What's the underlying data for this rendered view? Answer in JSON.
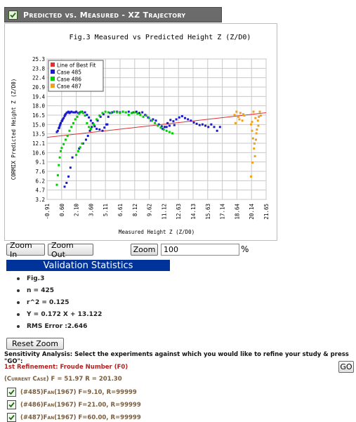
{
  "header": {
    "title": "Predicted vs. Measured - XZ Trajectory",
    "checkbox_checked": true
  },
  "chart_data": {
    "type": "scatter",
    "title": "Fig.3 Measured vs Predicted Height Z (Z/D0)",
    "xlabel": "Measured Height Z (Z/D0)",
    "ylabel": "CORMIX Predicted Height Z (Z/D0)",
    "xticks": [
      "-0.91",
      "0.60",
      "2.10",
      "3.60",
      "5.11",
      "6.61",
      "8.12",
      "9.62",
      "11.12",
      "12.63",
      "14.13",
      "15.63",
      "17.14",
      "18.64",
      "20.14",
      "21.65"
    ],
    "yticks": [
      "3.2",
      "4.7",
      "6.2",
      "7.6",
      "9.1",
      "10.6",
      "12.1",
      "13.5",
      "15.0",
      "16.5",
      "18.0",
      "19.4",
      "20.9",
      "22.4",
      "23.8",
      "25.3"
    ],
    "xlim": [
      -0.91,
      21.65
    ],
    "ylim": [
      3.2,
      25.3
    ],
    "grid": true,
    "legend_position": "top-left",
    "best_fit": {
      "name": "Line of Best Fit",
      "slope": 0.172,
      "intercept": 13.122,
      "color": "#e03030"
    },
    "series": [
      {
        "name": "Case 485",
        "color": "#1a1acc",
        "x": [
          0.1,
          0.2,
          0.3,
          0.35,
          0.4,
          0.45,
          0.5,
          0.6,
          0.65,
          0.7,
          0.8,
          0.9,
          0.95,
          1.0,
          1.1,
          1.2,
          1.3,
          1.4,
          1.5,
          1.6,
          1.8,
          2.0,
          2.1,
          2.3,
          2.5,
          2.7,
          3.0,
          3.2,
          3.4,
          3.6,
          3.8,
          4.0,
          4.2,
          4.5,
          4.8,
          5.0,
          5.2,
          5.4,
          5.6,
          5.8,
          6.0,
          6.3,
          6.6,
          6.9,
          7.2,
          7.5,
          7.8,
          8.0,
          8.3,
          8.6,
          8.9,
          9.2,
          9.5,
          9.8,
          10.0,
          10.3,
          10.6,
          10.9,
          11.2,
          11.5,
          11.8,
          12.1,
          12.4,
          12.7,
          13.0,
          13.3,
          13.6,
          13.9,
          14.2,
          14.5,
          14.8,
          15.1,
          15.4,
          15.7,
          16.0,
          16.3,
          16.6,
          16.9,
          0.9,
          1.1,
          1.3,
          1.5,
          1.7,
          2.4,
          2.8,
          3.1,
          3.3,
          3.5,
          3.7,
          4.3,
          4.6,
          4.9,
          5.3,
          11.0,
          11.4,
          11.7,
          12.2
        ],
        "y": [
          13.8,
          14.0,
          14.4,
          14.5,
          14.8,
          15.0,
          15.2,
          15.5,
          15.6,
          15.8,
          16.0,
          16.3,
          16.5,
          16.6,
          16.8,
          16.9,
          17.0,
          16.8,
          16.9,
          17.0,
          16.9,
          16.9,
          17.0,
          16.8,
          16.9,
          17.0,
          16.9,
          16.5,
          16.1,
          15.6,
          15.2,
          14.7,
          14.3,
          14.2,
          14.0,
          14.5,
          15.0,
          16.2,
          16.8,
          16.9,
          17.0,
          17.0,
          16.9,
          17.0,
          16.9,
          17.0,
          16.8,
          16.9,
          17.0,
          16.8,
          16.9,
          16.5,
          16.1,
          15.6,
          15.8,
          15.6,
          15.0,
          14.7,
          14.6,
          15.2,
          15.7,
          15.5,
          15.8,
          16.1,
          16.3,
          16.0,
          15.8,
          15.6,
          15.3,
          15.1,
          14.9,
          15.0,
          14.8,
          14.6,
          15.0,
          14.6,
          14.0,
          14.6,
          5.2,
          5.8,
          6.8,
          8.2,
          9.8,
          11.2,
          12.0,
          12.6,
          13.2,
          14.0,
          14.6,
          15.6,
          16.2,
          16.6,
          15.0,
          14.3,
          14.6,
          14.8,
          14.9
        ]
      },
      {
        "name": "Case 486",
        "color": "#00cc00",
        "x": [
          0.1,
          0.2,
          0.3,
          0.4,
          0.5,
          0.6,
          0.8,
          1.0,
          1.2,
          1.4,
          1.6,
          1.8,
          2.0,
          2.2,
          2.4,
          2.6,
          2.8,
          3.0,
          3.2,
          3.4,
          3.6,
          3.9,
          4.2,
          4.5,
          4.8,
          5.1,
          5.4,
          5.7,
          6.0,
          6.3,
          6.6,
          6.9,
          7.2,
          7.5,
          7.8,
          8.1,
          8.4,
          8.7,
          9.0,
          9.3,
          9.6,
          9.9,
          10.2,
          10.5,
          10.8,
          11.1,
          11.4,
          11.7,
          12.0,
          2.1,
          2.3,
          2.5,
          2.7
        ],
        "y": [
          5.5,
          7.0,
          8.6,
          9.8,
          10.8,
          11.3,
          11.9,
          12.6,
          13.2,
          14.0,
          14.6,
          15.2,
          15.8,
          16.2,
          16.7,
          17.0,
          16.8,
          16.4,
          15.2,
          14.6,
          14.3,
          15.0,
          15.8,
          16.4,
          16.8,
          17.0,
          16.9,
          16.8,
          17.0,
          16.9,
          16.8,
          17.0,
          16.9,
          16.5,
          16.8,
          16.9,
          16.7,
          16.5,
          16.2,
          16.4,
          16.0,
          15.6,
          15.2,
          14.8,
          14.5,
          14.2,
          14.0,
          13.8,
          13.6,
          10.2,
          10.8,
          11.4,
          12.0
        ]
      },
      {
        "name": "Case 487",
        "color": "#f0a020",
        "x": [
          18.4,
          18.6,
          18.8,
          19.0,
          19.2,
          19.4,
          18.5,
          18.9,
          19.3,
          20.1,
          20.2,
          20.3,
          20.4,
          20.5,
          20.6,
          20.7,
          20.8,
          20.9,
          21.0,
          21.1,
          20.25,
          20.45,
          20.65,
          20.85,
          20.2,
          20.35,
          20.55,
          20.1
        ],
        "y": [
          16.5,
          17.0,
          16.2,
          16.8,
          15.6,
          16.4,
          15.2,
          15.8,
          16.6,
          15.0,
          14.0,
          12.8,
          11.2,
          10.0,
          12.6,
          14.2,
          15.6,
          16.2,
          17.0,
          16.4,
          9.0,
          12.0,
          13.6,
          14.8,
          15.4,
          17.0,
          16.0,
          6.8
        ]
      }
    ]
  },
  "controls": {
    "zoom_in_label": "Zoom In",
    "zoom_out_label": "Zoom Out",
    "zoom_label": "Zoom",
    "zoom_value": "100",
    "pct_symbol": "%",
    "reset_label": "Reset Zoom",
    "go_label": "GO"
  },
  "stats": {
    "title": "Validation Statistics",
    "items": [
      "Fig.3",
      "n = 425",
      "r^2 = 0.125",
      "Y = 0.172 X + 13.122",
      "RMS Error :2.646"
    ]
  },
  "sensitivity": {
    "text": "Sensitivity Analysis: Select the experiments against which you would like to refine your study & press \"GO\":",
    "refinement": "1st Refinement: Froude Number (F0)",
    "current_case": "(Current Case) F = 51.97 R = 201.30",
    "experiments": [
      {
        "label": "(#485)Fan(1967) F=9.10, R=99999",
        "checked": true
      },
      {
        "label": "(#486)Fan(1967) F=21.00, R=99999",
        "checked": true
      },
      {
        "label": "(#487)Fan(1967) F=60.00, R=99999",
        "checked": true
      }
    ]
  }
}
